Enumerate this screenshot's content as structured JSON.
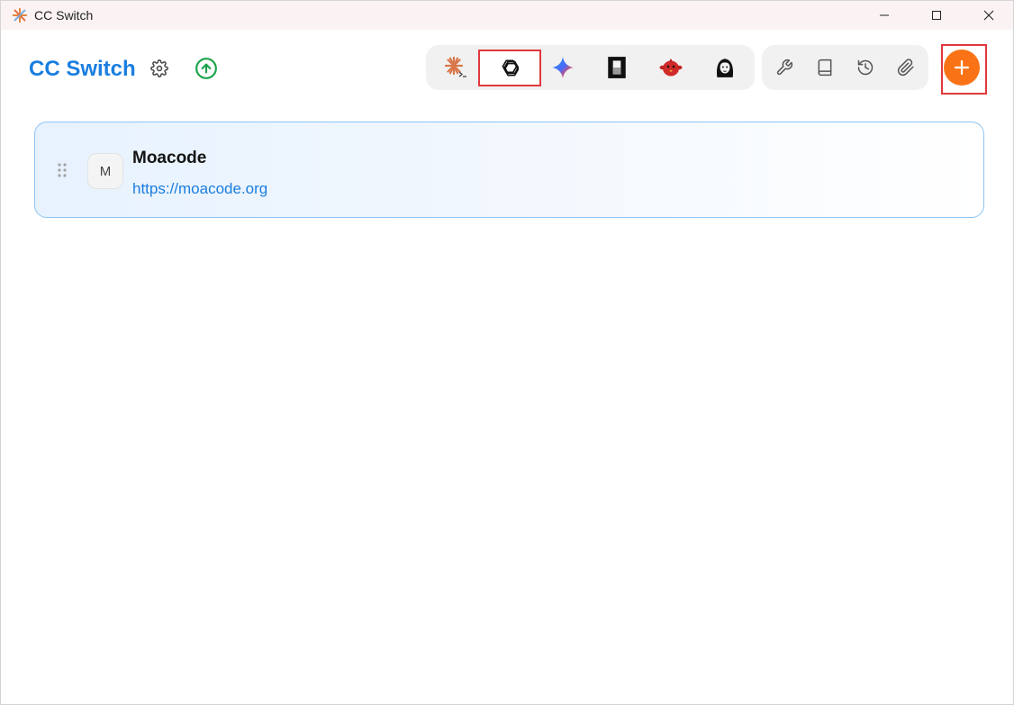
{
  "window": {
    "title": "CC Switch",
    "controls": [
      "minimize-icon",
      "maximize-icon",
      "close-icon"
    ]
  },
  "header": {
    "brand": "CC Switch",
    "accent_color": "#1a7ee0",
    "update_color": "#1aa34a"
  },
  "app_tabs": [
    {
      "name": "claude-code",
      "icon": "claude-asterisk-icon",
      "selected": false
    },
    {
      "name": "codex",
      "icon": "openai-knot-icon",
      "selected": true
    },
    {
      "name": "gemini",
      "icon": "gemini-sparkle-icon",
      "selected": false
    },
    {
      "name": "opencode",
      "icon": "opencode-block-icon",
      "selected": false
    },
    {
      "name": "red-mascot",
      "icon": "red-bird-icon",
      "selected": false
    },
    {
      "name": "portrait",
      "icon": "portrait-icon",
      "selected": false
    }
  ],
  "tools": [
    {
      "name": "wrench",
      "icon": "wrench-icon"
    },
    {
      "name": "book",
      "icon": "book-icon"
    },
    {
      "name": "history",
      "icon": "history-icon"
    },
    {
      "name": "paperclip",
      "icon": "paperclip-icon"
    }
  ],
  "add_button": {
    "icon": "plus-icon",
    "color": "#f97316"
  },
  "providers": [
    {
      "initial": "M",
      "name": "Moacode",
      "url": "https://moacode.org"
    }
  ]
}
